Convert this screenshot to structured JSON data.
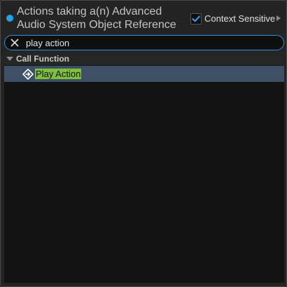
{
  "header": {
    "title": "Actions taking a(n) Advanced Audio System Object Reference",
    "context_sensitive_label": "Context Sensitive",
    "context_sensitive_checked": true,
    "accent_color": "#1fa3e8"
  },
  "search": {
    "value": "play action",
    "clear_icon": "close-icon"
  },
  "results": {
    "categories": [
      {
        "label": "Call Function",
        "expanded": true,
        "items": [
          {
            "label": "Play Action",
            "icon": "function-icon",
            "selected": true,
            "highlight_color": "#7fbf3f"
          }
        ]
      }
    ]
  }
}
